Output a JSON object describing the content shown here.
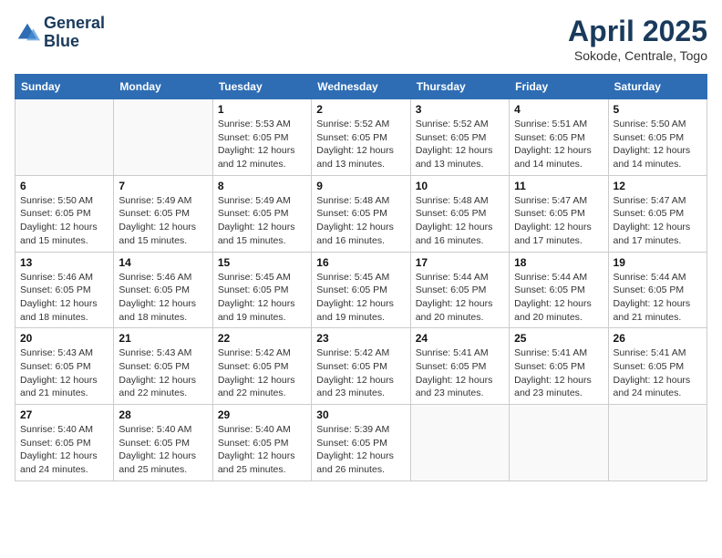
{
  "header": {
    "logo_line1": "General",
    "logo_line2": "Blue",
    "month_year": "April 2025",
    "location": "Sokode, Centrale, Togo"
  },
  "weekdays": [
    "Sunday",
    "Monday",
    "Tuesday",
    "Wednesday",
    "Thursday",
    "Friday",
    "Saturday"
  ],
  "weeks": [
    [
      {
        "day": "",
        "info": ""
      },
      {
        "day": "",
        "info": ""
      },
      {
        "day": "1",
        "info": "Sunrise: 5:53 AM\nSunset: 6:05 PM\nDaylight: 12 hours and 12 minutes."
      },
      {
        "day": "2",
        "info": "Sunrise: 5:52 AM\nSunset: 6:05 PM\nDaylight: 12 hours and 13 minutes."
      },
      {
        "day": "3",
        "info": "Sunrise: 5:52 AM\nSunset: 6:05 PM\nDaylight: 12 hours and 13 minutes."
      },
      {
        "day": "4",
        "info": "Sunrise: 5:51 AM\nSunset: 6:05 PM\nDaylight: 12 hours and 14 minutes."
      },
      {
        "day": "5",
        "info": "Sunrise: 5:50 AM\nSunset: 6:05 PM\nDaylight: 12 hours and 14 minutes."
      }
    ],
    [
      {
        "day": "6",
        "info": "Sunrise: 5:50 AM\nSunset: 6:05 PM\nDaylight: 12 hours and 15 minutes."
      },
      {
        "day": "7",
        "info": "Sunrise: 5:49 AM\nSunset: 6:05 PM\nDaylight: 12 hours and 15 minutes."
      },
      {
        "day": "8",
        "info": "Sunrise: 5:49 AM\nSunset: 6:05 PM\nDaylight: 12 hours and 15 minutes."
      },
      {
        "day": "9",
        "info": "Sunrise: 5:48 AM\nSunset: 6:05 PM\nDaylight: 12 hours and 16 minutes."
      },
      {
        "day": "10",
        "info": "Sunrise: 5:48 AM\nSunset: 6:05 PM\nDaylight: 12 hours and 16 minutes."
      },
      {
        "day": "11",
        "info": "Sunrise: 5:47 AM\nSunset: 6:05 PM\nDaylight: 12 hours and 17 minutes."
      },
      {
        "day": "12",
        "info": "Sunrise: 5:47 AM\nSunset: 6:05 PM\nDaylight: 12 hours and 17 minutes."
      }
    ],
    [
      {
        "day": "13",
        "info": "Sunrise: 5:46 AM\nSunset: 6:05 PM\nDaylight: 12 hours and 18 minutes."
      },
      {
        "day": "14",
        "info": "Sunrise: 5:46 AM\nSunset: 6:05 PM\nDaylight: 12 hours and 18 minutes."
      },
      {
        "day": "15",
        "info": "Sunrise: 5:45 AM\nSunset: 6:05 PM\nDaylight: 12 hours and 19 minutes."
      },
      {
        "day": "16",
        "info": "Sunrise: 5:45 AM\nSunset: 6:05 PM\nDaylight: 12 hours and 19 minutes."
      },
      {
        "day": "17",
        "info": "Sunrise: 5:44 AM\nSunset: 6:05 PM\nDaylight: 12 hours and 20 minutes."
      },
      {
        "day": "18",
        "info": "Sunrise: 5:44 AM\nSunset: 6:05 PM\nDaylight: 12 hours and 20 minutes."
      },
      {
        "day": "19",
        "info": "Sunrise: 5:44 AM\nSunset: 6:05 PM\nDaylight: 12 hours and 21 minutes."
      }
    ],
    [
      {
        "day": "20",
        "info": "Sunrise: 5:43 AM\nSunset: 6:05 PM\nDaylight: 12 hours and 21 minutes."
      },
      {
        "day": "21",
        "info": "Sunrise: 5:43 AM\nSunset: 6:05 PM\nDaylight: 12 hours and 22 minutes."
      },
      {
        "day": "22",
        "info": "Sunrise: 5:42 AM\nSunset: 6:05 PM\nDaylight: 12 hours and 22 minutes."
      },
      {
        "day": "23",
        "info": "Sunrise: 5:42 AM\nSunset: 6:05 PM\nDaylight: 12 hours and 23 minutes."
      },
      {
        "day": "24",
        "info": "Sunrise: 5:41 AM\nSunset: 6:05 PM\nDaylight: 12 hours and 23 minutes."
      },
      {
        "day": "25",
        "info": "Sunrise: 5:41 AM\nSunset: 6:05 PM\nDaylight: 12 hours and 23 minutes."
      },
      {
        "day": "26",
        "info": "Sunrise: 5:41 AM\nSunset: 6:05 PM\nDaylight: 12 hours and 24 minutes."
      }
    ],
    [
      {
        "day": "27",
        "info": "Sunrise: 5:40 AM\nSunset: 6:05 PM\nDaylight: 12 hours and 24 minutes."
      },
      {
        "day": "28",
        "info": "Sunrise: 5:40 AM\nSunset: 6:05 PM\nDaylight: 12 hours and 25 minutes."
      },
      {
        "day": "29",
        "info": "Sunrise: 5:40 AM\nSunset: 6:05 PM\nDaylight: 12 hours and 25 minutes."
      },
      {
        "day": "30",
        "info": "Sunrise: 5:39 AM\nSunset: 6:05 PM\nDaylight: 12 hours and 26 minutes."
      },
      {
        "day": "",
        "info": ""
      },
      {
        "day": "",
        "info": ""
      },
      {
        "day": "",
        "info": ""
      }
    ]
  ]
}
